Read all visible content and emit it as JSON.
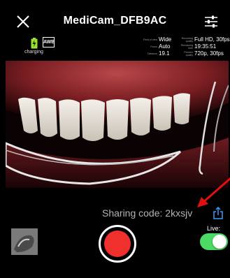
{
  "header": {
    "title": "MediCam_DFB9AC"
  },
  "status": {
    "awb_label": "AWB",
    "charging_label": "charging"
  },
  "camera_info": {
    "col1": [
      {
        "label": "Field of view",
        "value": "Wide"
      },
      {
        "label": "Focus",
        "value": "Auto"
      },
      {
        "label": "Distance",
        "value": "19.1"
      }
    ],
    "col2": [
      {
        "label": "Recording quality",
        "value": "Full HD, 30fps"
      },
      {
        "label": "Remaining time",
        "value": "19:35:51"
      },
      {
        "label": "Preview quality",
        "value": "720p, 30fps"
      }
    ]
  },
  "sharing": {
    "prefix": "Sharing code: ",
    "code": "2kxsjv"
  },
  "controls": {
    "live_label": "Live:",
    "live_on": true
  },
  "colors": {
    "record": "#f0302c",
    "toggle_on": "#4cd964",
    "annotation_arrow": "#e01010"
  },
  "icons": {
    "close": "close-icon",
    "settings": "sliders-icon",
    "battery": "battery-charging-icon",
    "share": "share-icon"
  }
}
